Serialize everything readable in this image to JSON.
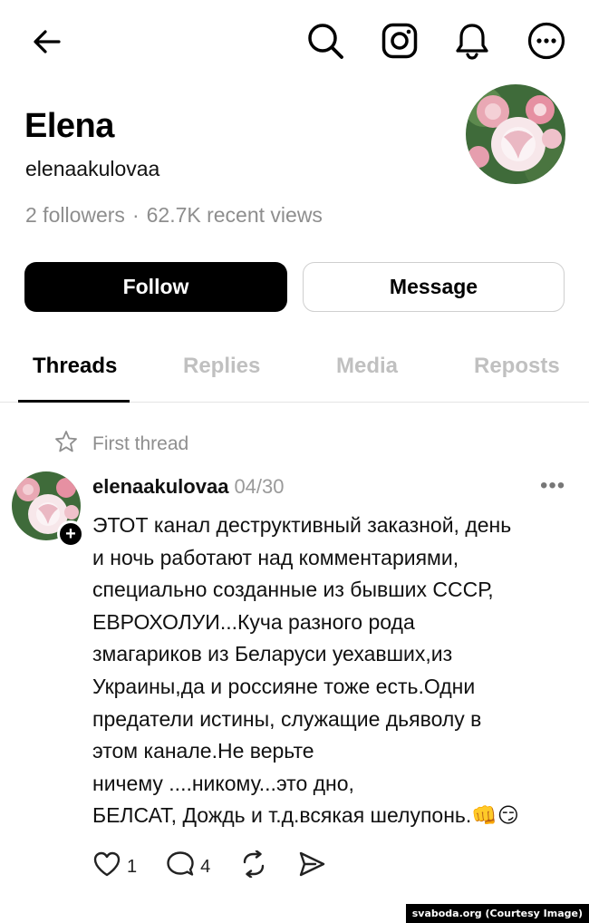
{
  "profile": {
    "name": "Elena",
    "handle": "elenaakulovaa",
    "followers": "2 followers",
    "separator": "·",
    "views": "62.7K recent views"
  },
  "buttons": {
    "follow": "Follow",
    "message": "Message"
  },
  "tabs": [
    "Threads",
    "Replies",
    "Media",
    "Reposts"
  ],
  "active_tab": "Threads",
  "pinned_label": "First thread",
  "post": {
    "user": "elenaakulovaa",
    "date": "04/30",
    "more": "•••",
    "body": "ЭТОТ канал деструктивный заказной, день\nи ночь работают над комментариями,\nспециально созданные из бывших СССР,\nЕВРОХОЛУИ...Куча разного рода\nзмагариков из Беларуси уехавших,из\nУкраины,да и россияне тоже есть.Одни\nпредатели истины, служащие дьяволу в\nэтом канале.Не верьте\nничему ....никому...это дно,\nБЕЛСАТ, Дождь и т.д.всякая шелупонь.👊😏",
    "likes": "1",
    "replies": "4"
  },
  "watermark": "svaboda.org (Courtesy Image)",
  "icons": {
    "back": "back-arrow-icon",
    "search": "search-icon",
    "instagram": "instagram-icon",
    "notifications": "bell-icon",
    "more": "more-icon",
    "pinned": "star-icon",
    "like": "heart-icon",
    "reply": "comment-icon",
    "repost": "repost-icon",
    "share": "send-icon"
  },
  "colors": {
    "primary": "#000000",
    "muted": "#8e8e8e",
    "inactive_tab": "#c0c0c0",
    "border": "#cfcfcf"
  }
}
